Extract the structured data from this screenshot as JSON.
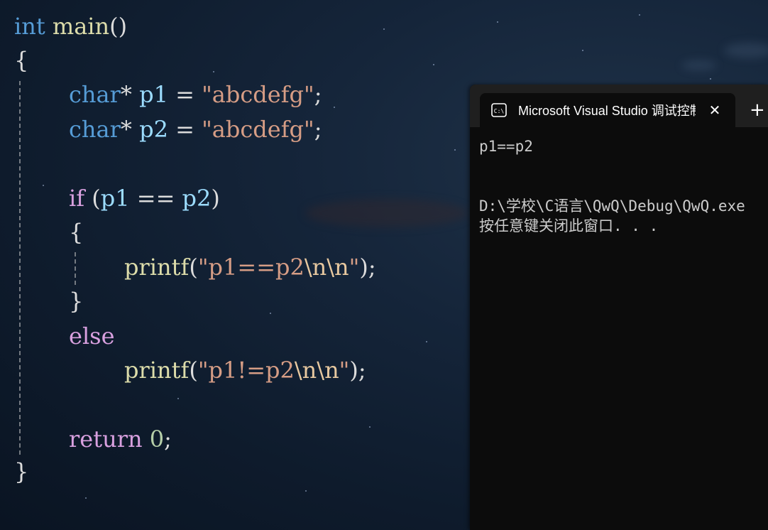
{
  "code": {
    "l1": {
      "kw": "int",
      "fn": "main",
      "rest": "()"
    },
    "l2": "{",
    "l3": {
      "type": "char",
      "star": "*",
      "var": "p1",
      "eq": " = ",
      "str": "\"abcdefg\"",
      "semi": ";"
    },
    "l4": {
      "type": "char",
      "star": "*",
      "var": "p2",
      "eq": " = ",
      "str": "\"abcdefg\"",
      "semi": ";"
    },
    "l6": {
      "kw": "if",
      "open": " (",
      "a": "p1",
      "op": " == ",
      "b": "p2",
      "close": ")"
    },
    "l7": "{",
    "l8": {
      "fn": "printf",
      "open": "(",
      "s1": "\"p1==p2",
      "e1": "\\n",
      "e2": "\\n",
      "s2": "\"",
      "close": ");"
    },
    "l9": "}",
    "l10": {
      "kw": "else"
    },
    "l11": {
      "fn": "printf",
      "open": "(",
      "s1": "\"p1!=p2",
      "e1": "\\n",
      "e2": "\\n",
      "s2": "\"",
      "close": ");"
    },
    "l13": {
      "kw": "return",
      "num": "0",
      "semi": ";"
    },
    "l14": "}"
  },
  "terminal": {
    "icon": "console-icon",
    "tab_title": "Microsoft Visual Studio 调试控制台",
    "close_symbol": "✕",
    "new_tab_symbol": "+",
    "output": [
      "p1==p2",
      "",
      "",
      "D:\\学校\\C语言\\QwQ\\Debug\\QwQ.exe",
      "按任意键关闭此窗口. . ."
    ]
  },
  "colors": {
    "keyword_type": "#569cd6",
    "keyword_control": "#d8a0df",
    "function": "#dcdcaa",
    "variable": "#9cdcfe",
    "string": "#d69d85",
    "terminal_bg": "#0c0c0c"
  }
}
